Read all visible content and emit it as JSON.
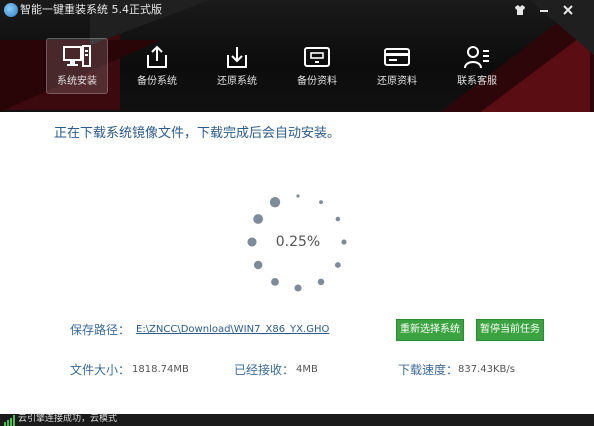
{
  "window": {
    "title": "智能一键重装系统 5.4正式版",
    "logo_icon": "app-logo-icon",
    "controls": [
      "skin-icon",
      "minimize-icon",
      "close-icon"
    ]
  },
  "nav": {
    "items": [
      {
        "label": "系统安装",
        "icon": "monitor-icon",
        "active": true
      },
      {
        "label": "备份系统",
        "icon": "upload-icon",
        "active": false
      },
      {
        "label": "还原系统",
        "icon": "download-icon",
        "active": false
      },
      {
        "label": "备份资料",
        "icon": "archive-box-icon",
        "active": false
      },
      {
        "label": "还原资料",
        "icon": "card-icon",
        "active": false
      },
      {
        "label": "联系客服",
        "icon": "contact-icon",
        "active": false
      }
    ]
  },
  "main": {
    "status_message": "正在下载系统镜像文件，下载完成后会自动安装。",
    "progress_text": "0.25%",
    "path_label": "保存路径：",
    "path_value": "E:\\ZNCC\\Download\\WIN7_X86_YX.GHO",
    "reselect_button": "重新选择系统",
    "pause_button": "暂停当前任务",
    "size_label": "文件大小：",
    "size_value": "1818.74MB",
    "received_label": "已经接收：",
    "received_value": "4MB",
    "speed_label": "下载速度：",
    "speed_value": "837.43KB/s"
  },
  "statusbar": {
    "text": "云引擎连接成功，云模式"
  },
  "colors": {
    "accent_blue": "#2d5b8c",
    "button_green": "#3aa33f",
    "spinner_dot": "#7e8c99"
  }
}
